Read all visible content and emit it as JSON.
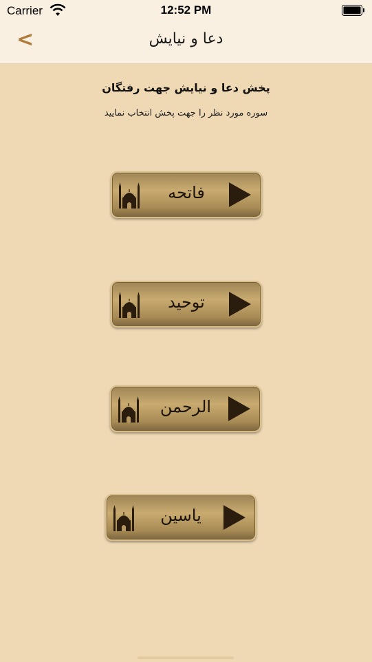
{
  "status_bar": {
    "carrier": "Carrier",
    "time": "12:52 PM"
  },
  "nav": {
    "back_label": "<",
    "title": "دعا و نیایش"
  },
  "content": {
    "heading": "پخش دعا و نیایش جهت رفتگان",
    "subheading": "سوره مورد نظر را جهت پخش انتخاب نمایید"
  },
  "surahs": [
    {
      "label": "فاتحه"
    },
    {
      "label": "توحید"
    },
    {
      "label": "الرحمن"
    },
    {
      "label": "یاسین"
    }
  ],
  "colors": {
    "background": "#efd9b4",
    "accent": "#b07b3c",
    "button": "#b69760"
  }
}
